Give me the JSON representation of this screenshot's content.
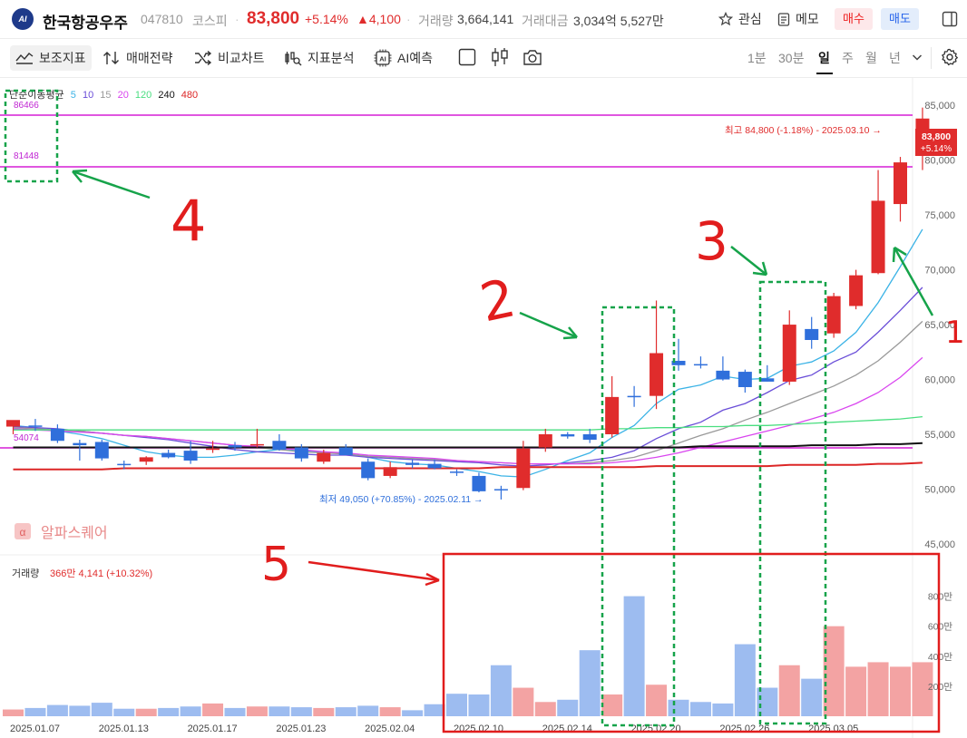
{
  "header": {
    "stock_name": "한국항공우주",
    "code": "047810",
    "market": "코스피",
    "price": "83,800",
    "change_pct": "+5.14%",
    "change_abs": "▲4,100",
    "volume_label": "거래량",
    "volume": "3,664,141",
    "value_label": "거래대금",
    "value": "3,034억 5,527만",
    "watch_label": "관심",
    "memo_label": "메모",
    "buy_label": "매수",
    "sell_label": "매도",
    "logo_text": "AI",
    "colors": {
      "up": "#e02c2c",
      "down": "#2f6fdb",
      "brand": "#1e3a8a"
    }
  },
  "toolbar": {
    "indicators": "보조지표",
    "strategy": "매매전략",
    "compare": "비교차트",
    "analysis": "지표분석",
    "ai_predict": "AI예측",
    "ai_chip": "AI",
    "timeframes": [
      "1분",
      "30분",
      "일",
      "주",
      "월",
      "년"
    ],
    "active_timeframe": "일"
  },
  "chart_data": {
    "type": "candlestick",
    "ma_title": "단순이동평균",
    "ma_periods": [
      {
        "label": "5",
        "color": "#3bb3e6"
      },
      {
        "label": "10",
        "color": "#6a4ed8"
      },
      {
        "label": "15",
        "color": "#999999"
      },
      {
        "label": "20",
        "color": "#d946ef"
      },
      {
        "label": "120",
        "color": "#4ade80"
      },
      {
        "label": "240",
        "color": "#111111"
      },
      {
        "label": "480",
        "color": "#dc2626"
      }
    ],
    "y_ticks": [
      "85,000",
      "80,000",
      "75,000",
      "70,000",
      "65,000",
      "60,000",
      "55,000",
      "50,000",
      "45,000"
    ],
    "y_tick_values": [
      85000,
      80000,
      75000,
      70000,
      65000,
      60000,
      55000,
      50000,
      45000
    ],
    "ylim": [
      44000,
      87500
    ],
    "x_ticks": [
      "2025.01.07",
      "2025.01.13",
      "2025.01.17",
      "2025.01.23",
      "2025.02.04",
      "2025.02.10",
      "2025.02.14",
      "2025.02.20",
      "2025.02.26",
      "2025.03.05"
    ],
    "x_tick_index": [
      0,
      4,
      8,
      12,
      16,
      20,
      24,
      28,
      32,
      36
    ],
    "price_levels": [
      {
        "label": "86466",
        "value": 86466
      },
      {
        "label": "81448",
        "value": 81448
      },
      {
        "label": "54074",
        "value": 54074
      }
    ],
    "high_label": "최고 84,800 (-1.18%) - 2025.03.10 →",
    "low_label": "최저 49,050 (+70.85%) - 2025.02.11 →",
    "current_price": "83,800",
    "current_change": "+5.14%",
    "candles": [
      {
        "o": 55700,
        "h": 56000,
        "l": 55000,
        "c": 56300
      },
      {
        "o": 55800,
        "h": 56400,
        "l": 55300,
        "c": 55700
      },
      {
        "o": 55500,
        "h": 55900,
        "l": 54200,
        "c": 54400
      },
      {
        "o": 54200,
        "h": 54500,
        "l": 52600,
        "c": 54000
      },
      {
        "o": 54300,
        "h": 54500,
        "l": 52600,
        "c": 52800
      },
      {
        "o": 52300,
        "h": 52600,
        "l": 51800,
        "c": 52200
      },
      {
        "o": 52500,
        "h": 53000,
        "l": 52200,
        "c": 52900
      },
      {
        "o": 53300,
        "h": 53600,
        "l": 52800,
        "c": 52900
      },
      {
        "o": 53500,
        "h": 54400,
        "l": 52300,
        "c": 52600
      },
      {
        "o": 53600,
        "h": 54400,
        "l": 53300,
        "c": 53700
      },
      {
        "o": 54000,
        "h": 54300,
        "l": 53500,
        "c": 53800
      },
      {
        "o": 54100,
        "h": 55500,
        "l": 53800,
        "c": 54100
      },
      {
        "o": 54400,
        "h": 55000,
        "l": 53500,
        "c": 53600
      },
      {
        "o": 53800,
        "h": 54100,
        "l": 52500,
        "c": 52800
      },
      {
        "o": 52500,
        "h": 53600,
        "l": 52300,
        "c": 53300
      },
      {
        "o": 53800,
        "h": 54100,
        "l": 53200,
        "c": 53100
      },
      {
        "o": 52500,
        "h": 52800,
        "l": 50800,
        "c": 51000
      },
      {
        "o": 51200,
        "h": 52500,
        "l": 51000,
        "c": 52000
      },
      {
        "o": 52400,
        "h": 52700,
        "l": 51900,
        "c": 52200
      },
      {
        "o": 52300,
        "h": 52700,
        "l": 51800,
        "c": 51900
      },
      {
        "o": 51600,
        "h": 51800,
        "l": 51200,
        "c": 51500
      },
      {
        "o": 51200,
        "h": 51500,
        "l": 49700,
        "c": 49800
      },
      {
        "o": 50000,
        "h": 50300,
        "l": 49050,
        "c": 49900
      },
      {
        "o": 50100,
        "h": 54400,
        "l": 49900,
        "c": 53700
      },
      {
        "o": 53800,
        "h": 55500,
        "l": 53400,
        "c": 55000
      },
      {
        "o": 55000,
        "h": 55200,
        "l": 54600,
        "c": 54800
      },
      {
        "o": 55000,
        "h": 55500,
        "l": 54200,
        "c": 54500
      },
      {
        "o": 55000,
        "h": 60300,
        "l": 54700,
        "c": 58400
      },
      {
        "o": 58500,
        "h": 59400,
        "l": 57500,
        "c": 58400
      },
      {
        "o": 58500,
        "h": 67200,
        "l": 57300,
        "c": 62400
      },
      {
        "o": 61700,
        "h": 63700,
        "l": 60800,
        "c": 61300
      },
      {
        "o": 61400,
        "h": 62100,
        "l": 61000,
        "c": 61300
      },
      {
        "o": 60800,
        "h": 62100,
        "l": 59900,
        "c": 60000
      },
      {
        "o": 60700,
        "h": 60900,
        "l": 58800,
        "c": 59300
      },
      {
        "o": 60100,
        "h": 61300,
        "l": 59800,
        "c": 59800
      },
      {
        "o": 59800,
        "h": 66300,
        "l": 59500,
        "c": 65000
      },
      {
        "o": 64600,
        "h": 65700,
        "l": 62800,
        "c": 63600
      },
      {
        "o": 64200,
        "h": 67900,
        "l": 63800,
        "c": 67600
      },
      {
        "o": 66700,
        "h": 70000,
        "l": 66400,
        "c": 69500
      },
      {
        "o": 69700,
        "h": 79100,
        "l": 69600,
        "c": 76300
      },
      {
        "o": 76000,
        "h": 80300,
        "l": 74400,
        "c": 79800
      },
      {
        "o": 80600,
        "h": 84800,
        "l": 79100,
        "c": 83800
      }
    ],
    "ma_lines": [
      {
        "name": "5",
        "color": "#3bb3e6",
        "values": [
          55800,
          55600,
          55300,
          55000,
          54600,
          54000,
          53400,
          53100,
          52900,
          52900,
          53100,
          53400,
          53600,
          53500,
          53400,
          53200,
          52900,
          52500,
          52300,
          52200,
          51900,
          51600,
          51200,
          51100,
          51800,
          52600,
          53300,
          54700,
          55800,
          57800,
          59100,
          59500,
          60300,
          60000,
          60100,
          61200,
          61600,
          62600,
          64300,
          67000,
          70300,
          73700
        ]
      },
      {
        "name": "10",
        "color": "#6a4ed8",
        "values": [
          55700,
          55600,
          55500,
          55300,
          55100,
          54900,
          54700,
          54500,
          54200,
          53900,
          53600,
          53400,
          53300,
          53200,
          53100,
          53100,
          52900,
          52800,
          52700,
          52600,
          52500,
          52400,
          52200,
          52100,
          52200,
          52400,
          52600,
          52900,
          53500,
          54600,
          55500,
          56100,
          57200,
          57800,
          58800,
          59900,
          60400,
          61600,
          62500,
          64300,
          66300,
          68400
        ]
      },
      {
        "name": "15",
        "color": "#999999",
        "values": [
          55600,
          55500,
          55400,
          55300,
          55100,
          54900,
          54800,
          54600,
          54400,
          54200,
          54000,
          53800,
          53600,
          53400,
          53300,
          53200,
          53000,
          52900,
          52800,
          52700,
          52600,
          52500,
          52400,
          52300,
          52300,
          52300,
          52400,
          52600,
          52900,
          53500,
          54200,
          54900,
          55500,
          56300,
          57000,
          57800,
          58600,
          59400,
          60400,
          61700,
          63400,
          65300
        ]
      },
      {
        "name": "20",
        "color": "#d946ef",
        "values": [
          55500,
          55400,
          55300,
          55200,
          55100,
          54900,
          54800,
          54600,
          54400,
          54200,
          54000,
          53900,
          53700,
          53600,
          53400,
          53300,
          53100,
          53000,
          52900,
          52800,
          52600,
          52500,
          52400,
          52300,
          52300,
          52300,
          52300,
          52400,
          52600,
          52900,
          53300,
          53800,
          54300,
          54800,
          55300,
          55800,
          56400,
          57000,
          57800,
          58800,
          60200,
          62000
        ]
      },
      {
        "name": "120",
        "color": "#4ade80",
        "values": [
          55400,
          55400,
          55400,
          55400,
          55400,
          55400,
          55400,
          55400,
          55400,
          55400,
          55400,
          55400,
          55400,
          55400,
          55400,
          55400,
          55400,
          55400,
          55400,
          55400,
          55400,
          55400,
          55400,
          55400,
          55400,
          55400,
          55400,
          55500,
          55500,
          55600,
          55600,
          55700,
          55700,
          55800,
          55800,
          55900,
          56000,
          56100,
          56200,
          56300,
          56400,
          56600
        ]
      },
      {
        "name": "240",
        "color": "#111111",
        "values": [
          53800,
          53800,
          53800,
          53800,
          53800,
          53800,
          53800,
          53800,
          53800,
          53800,
          53800,
          53800,
          53800,
          53800,
          53800,
          53800,
          53800,
          53800,
          53800,
          53800,
          53800,
          53800,
          53800,
          53800,
          53800,
          53800,
          53800,
          53800,
          53800,
          53800,
          53800,
          53900,
          53900,
          53900,
          53900,
          53900,
          54000,
          54000,
          54000,
          54100,
          54100,
          54200
        ]
      },
      {
        "name": "480",
        "color": "#dc2626",
        "values": [
          51800,
          51800,
          51800,
          51800,
          51800,
          51900,
          51900,
          51900,
          51900,
          51900,
          51900,
          51900,
          51900,
          51900,
          51900,
          51900,
          51900,
          51900,
          51900,
          51900,
          51900,
          51900,
          52000,
          52000,
          52000,
          52000,
          52000,
          52000,
          52000,
          52100,
          52100,
          52100,
          52100,
          52100,
          52100,
          52200,
          52200,
          52200,
          52200,
          52300,
          52300,
          52400
        ]
      }
    ],
    "volume": {
      "label": "거래량",
      "value": "366만 4,141 (+10.32%)",
      "y_ticks": [
        "800만",
        "600만",
        "400만",
        "200만"
      ],
      "y_tick_values": [
        800,
        600,
        400,
        200
      ],
      "ylim": [
        0,
        870
      ],
      "unit": "만",
      "values": [
        45,
        55,
        75,
        70,
        90,
        50,
        50,
        55,
        65,
        85,
        55,
        65,
        65,
        60,
        55,
        60,
        70,
        60,
        40,
        80,
        150,
        145,
        340,
        190,
        95,
        110,
        440,
        145,
        800,
        210,
        110,
        95,
        85,
        480,
        190,
        340,
        250,
        600,
        330,
        360,
        330,
        360
      ]
    }
  },
  "annotations": {
    "labels": [
      "1",
      "2",
      "3",
      "4",
      "5"
    ],
    "box_color": "#16a34a",
    "arrow_color": "#16a34a",
    "volume_box_color": "#e11d1d",
    "label_color": "#e11d1d"
  },
  "watermark": "알파스퀘어"
}
